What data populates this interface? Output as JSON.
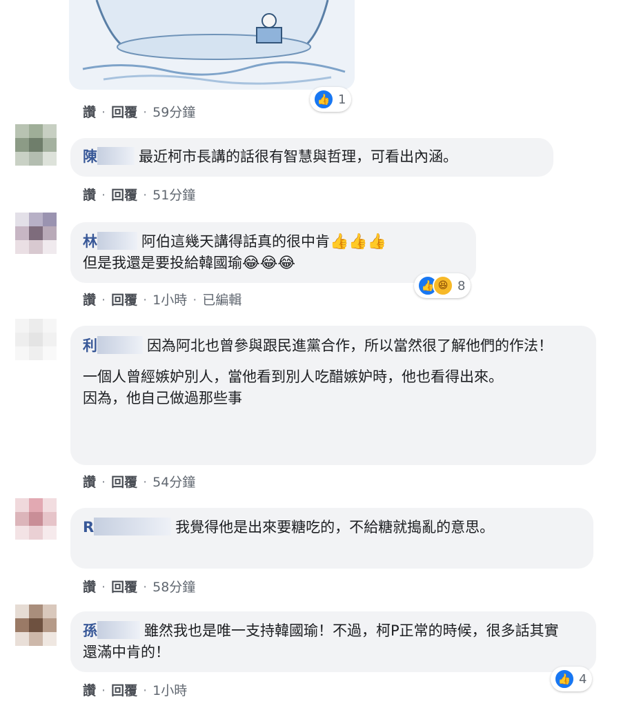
{
  "comments": [
    {
      "id": "c0",
      "body": [],
      "meta": {
        "like": "讚",
        "reply": "回覆",
        "time": "59分鐘"
      },
      "reactions": {
        "count": "1",
        "types": [
          "like"
        ]
      }
    },
    {
      "id": "c1",
      "name_prefix": "陳",
      "body": [
        "最近柯市長講的話很有智慧與哲理，可看出內涵。"
      ],
      "meta": {
        "like": "讚",
        "reply": "回覆",
        "time": "51分鐘"
      }
    },
    {
      "id": "c2",
      "name_prefix": "林",
      "body_line1": "阿伯這幾天講得話真的很中肯",
      "body_line1_emoji": "👍👍👍",
      "body_line2": "但是我還是要投給韓國瑜",
      "body_line2_emoji": "😂😂😂",
      "meta": {
        "like": "讚",
        "reply": "回覆",
        "time": "1小時",
        "edited": "已編輯"
      },
      "reactions": {
        "count": "8",
        "types": [
          "like",
          "haha"
        ]
      }
    },
    {
      "id": "c3",
      "name_prefix": "利",
      "body_p1": "因為阿北也曾參與跟民進黨合作，所以當然很了解他們的作法！",
      "body_p2": "一個人曾經嫉妒別人，當他看到別人吃醋嫉妒時，他也看得出來。",
      "body_p3": "因為，他自己做過那些事",
      "meta": {
        "like": "讚",
        "reply": "回覆",
        "time": "54分鐘"
      }
    },
    {
      "id": "c4",
      "name_prefix": "R",
      "body": "我覺得他是出來要糖吃的，不給糖就搗亂的意思。",
      "meta": {
        "like": "讚",
        "reply": "回覆",
        "time": "58分鐘"
      }
    },
    {
      "id": "c5",
      "name_prefix": "孫",
      "body": "雖然我也是唯一支持韓國瑜！不過，柯P正常的時候，很多話其實還滿中肯的！",
      "meta": {
        "like": "讚",
        "reply": "回覆",
        "time": "1小時"
      },
      "reactions": {
        "count": "4",
        "types": [
          "like"
        ]
      }
    }
  ],
  "colors": {
    "name": "#385898",
    "bubble": "#f2f3f5",
    "like_blue": "#1877f2",
    "haha_yellow": "#f7b928",
    "meta_text": "#606770"
  },
  "icons": [
    "like-icon",
    "haha-icon",
    "thumbs-up-emoji",
    "tears-of-joy-emoji"
  ]
}
